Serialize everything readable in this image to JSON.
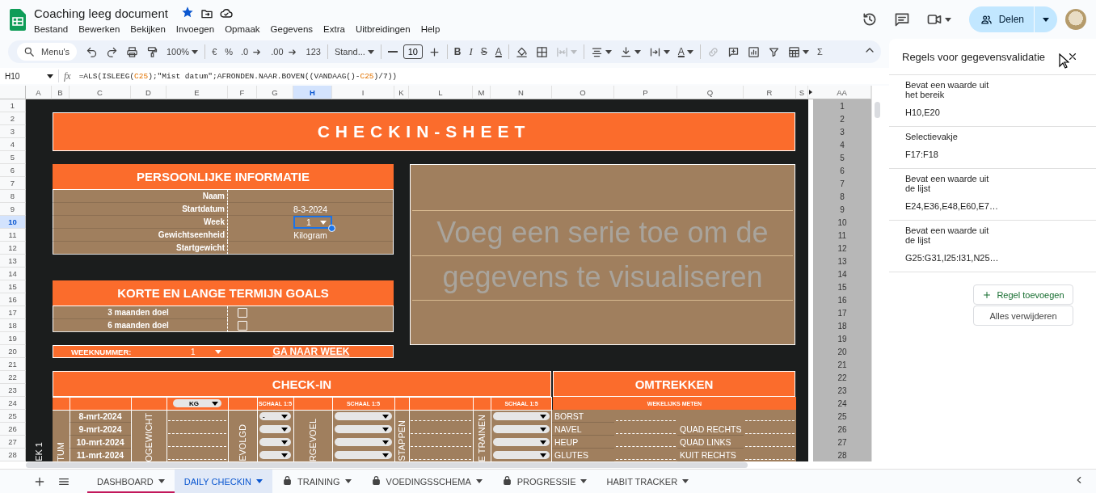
{
  "document": {
    "title": "Coaching leeg document",
    "starred": true
  },
  "menus": [
    "Bestand",
    "Bewerken",
    "Bekijken",
    "Invoegen",
    "Opmaak",
    "Gegevens",
    "Extra",
    "Uitbreidingen",
    "Help"
  ],
  "share": {
    "label": "Delen"
  },
  "toolbar": [
    [
      {
        "kind": "search",
        "placeholder": "Menu's",
        "disabled": false
      },
      {
        "kind": "undo",
        "disabled": false
      },
      {
        "kind": "redo",
        "disabled": false
      },
      {
        "kind": "print",
        "disabled": false
      },
      {
        "kind": "paint-format",
        "disabled": false
      },
      {
        "kind": "zoom",
        "label": "100%",
        "disabled": false
      }
    ],
    [
      {
        "kind": "currency",
        "label": "€",
        "disabled": false
      },
      {
        "kind": "percent",
        "label": "%",
        "disabled": false
      },
      {
        "kind": "decrease-decimals",
        "label": ".0",
        "disabled": false
      },
      {
        "kind": "increase-decimals",
        "label": ".00",
        "disabled": false
      },
      {
        "kind": "number-format",
        "label": "123",
        "disabled": false
      }
    ],
    [
      {
        "kind": "font",
        "label": "Stand...",
        "disabled": false
      }
    ],
    [
      {
        "kind": "minus",
        "disabled": false
      },
      {
        "kind": "size",
        "label": "10",
        "disabled": false
      },
      {
        "kind": "plus",
        "disabled": false
      }
    ],
    [
      {
        "kind": "bold",
        "label": "B",
        "disabled": false
      },
      {
        "kind": "italic",
        "label": "I",
        "disabled": false
      },
      {
        "kind": "strike",
        "label": "S",
        "disabled": false
      },
      {
        "kind": "text-color",
        "label": "A",
        "disabled": false
      }
    ],
    [
      {
        "kind": "fill",
        "disabled": false
      },
      {
        "kind": "borders",
        "disabled": false
      },
      {
        "kind": "merge",
        "disabled": true
      }
    ],
    [
      {
        "kind": "align",
        "disabled": false
      },
      {
        "kind": "valign",
        "disabled": false
      },
      {
        "kind": "wrap",
        "disabled": false
      },
      {
        "kind": "rotate",
        "label": "A",
        "disabled": false
      }
    ],
    [
      {
        "kind": "link",
        "disabled": true
      },
      {
        "kind": "comment",
        "disabled": false
      },
      {
        "kind": "chart",
        "disabled": false
      },
      {
        "kind": "filter",
        "disabled": false
      },
      {
        "kind": "functions-table",
        "disabled": false
      },
      {
        "kind": "sigma",
        "label": "Σ",
        "disabled": false
      }
    ]
  ],
  "formula_bar": {
    "cell": "H10",
    "fx": "fx",
    "segments": [
      {
        "kind": "text",
        "text": "=ALS(ISLEEG("
      },
      {
        "kind": "ref",
        "text": "C25"
      },
      {
        "kind": "text",
        "text": ");\"Mist datum\";AFRONDEN.NAAR.BOVEN((VANDAAG()-"
      },
      {
        "kind": "ref",
        "text": "C25"
      },
      {
        "kind": "text",
        "text": ")/7))"
      }
    ]
  },
  "columns": [
    {
      "label": "A",
      "selected": false
    },
    {
      "label": "B",
      "selected": false
    },
    {
      "label": "C",
      "selected": false
    },
    {
      "label": "D",
      "selected": false
    },
    {
      "label": "E",
      "selected": false
    },
    {
      "label": "F",
      "selected": false
    },
    {
      "label": "G",
      "selected": false
    },
    {
      "label": "H",
      "selected": true
    },
    {
      "label": "I",
      "selected": false
    },
    {
      "label": "K",
      "selected": false
    },
    {
      "label": "L",
      "selected": false
    },
    {
      "label": "M",
      "selected": false
    },
    {
      "label": "N",
      "selected": false
    },
    {
      "label": "O",
      "selected": false
    },
    {
      "label": "P",
      "selected": false
    },
    {
      "label": "Q",
      "selected": false
    },
    {
      "label": "R",
      "selected": false
    },
    {
      "label": "S",
      "selected": false
    },
    {
      "label": "AA",
      "selected": false
    }
  ],
  "rows": [
    {
      "label": "1",
      "selected": false
    },
    {
      "label": "2",
      "selected": false
    },
    {
      "label": "3",
      "selected": false
    },
    {
      "label": "4",
      "selected": false
    },
    {
      "label": "5",
      "selected": false
    },
    {
      "label": "6",
      "selected": false
    },
    {
      "label": "7",
      "selected": false
    },
    {
      "label": "8",
      "selected": false
    },
    {
      "label": "9",
      "selected": false
    },
    {
      "label": "10",
      "selected": true
    },
    {
      "label": "11",
      "selected": false
    },
    {
      "label": "12",
      "selected": false
    },
    {
      "label": "13",
      "selected": false
    },
    {
      "label": "14",
      "selected": false
    },
    {
      "label": "15",
      "selected": false
    },
    {
      "label": "16",
      "selected": false
    },
    {
      "label": "17",
      "selected": false
    },
    {
      "label": "18",
      "selected": false
    },
    {
      "label": "19",
      "selected": false
    },
    {
      "label": "20",
      "selected": false
    },
    {
      "label": "21",
      "selected": false
    },
    {
      "label": "22",
      "selected": false
    },
    {
      "label": "23",
      "selected": false
    },
    {
      "label": "24",
      "selected": false
    },
    {
      "label": "25",
      "selected": false
    },
    {
      "label": "26",
      "selected": false
    },
    {
      "label": "27",
      "selected": false
    },
    {
      "label": "28",
      "selected": false
    }
  ],
  "banner": "CHECKIN-SHEET",
  "personal": {
    "title": "PERSOONLIJKE INFORMATIE",
    "rows": [
      {
        "label": "Naam",
        "kind": "text",
        "selected": false
      },
      {
        "label": "Startdatum",
        "value": "8-3-2024",
        "kind": "text",
        "selected": false
      },
      {
        "label": "Week",
        "value": "1",
        "kind": "dropdown",
        "selected": true
      },
      {
        "label": "Gewichtseenheid",
        "value": "Kilogram",
        "kind": "text",
        "selected": false
      },
      {
        "label": "Startgewicht",
        "kind": "text",
        "selected": false
      }
    ]
  },
  "chart_placeholder": {
    "message": "Voeg een serie toe om de gegevens te visualiseren"
  },
  "goals": {
    "title": "KORTE EN LANGE TERMIJN GOALS",
    "rows": [
      {
        "label": "3 maanden doel",
        "checked": false
      },
      {
        "label": "6 maanden doel",
        "checked": false
      }
    ]
  },
  "week_picker": {
    "label": "WEEKNUMMER:",
    "value": "1",
    "link": "GA NAAR WEEK"
  },
  "checkin": {
    "title": "CHECK-IN",
    "week": "EK 1",
    "dates": [
      "8-mrt-2024",
      "9-mrt-2024",
      "10-mrt-2024",
      "11-mrt-2024"
    ],
    "columns": [
      {
        "kind": "label",
        "text": "TUM"
      },
      {
        "kind": "date"
      },
      {
        "kind": "label",
        "text": "OGEWICHT"
      },
      {
        "kind": "input",
        "unit": "KG"
      },
      {
        "kind": "label",
        "text": "EVOLGD"
      },
      {
        "kind": "scale",
        "header": "SCHAAL 1:5",
        "values": [
          "-"
        ]
      },
      {
        "kind": "label",
        "text": "RGEVOEL"
      },
      {
        "kind": "scale",
        "header": "SCHAAL 1:5"
      },
      {
        "kind": "label",
        "text": "STAPPEN"
      },
      {
        "kind": "input"
      },
      {
        "kind": "label",
        "text": "E TRAINEN"
      },
      {
        "kind": "scale",
        "header": "SCHAAL 1:5"
      }
    ]
  },
  "omtrekken": {
    "title": "OMTREKKEN",
    "subtitle": "WEKELIJKS METEN",
    "rows": [
      {
        "left": "BORST"
      },
      {
        "left": "NAVEL",
        "right": "QUAD RECHTS"
      },
      {
        "left": "HEUP",
        "right": "QUAD LINKS"
      },
      {
        "left": "GLUTES",
        "right": "KUIT RECHTS"
      }
    ]
  },
  "aa_values": [
    "1",
    "2",
    "3",
    "4",
    "5",
    "6",
    "7",
    "8",
    "9",
    "10",
    "11",
    "12",
    "13",
    "14",
    "15",
    "16",
    "17",
    "18",
    "19",
    "20",
    "21",
    "22",
    "23",
    "24",
    "25",
    "26",
    "27",
    "28"
  ],
  "validation_panel": {
    "title": "Regels voor gegevensvalidatie",
    "rules": [
      {
        "criterion": "Bevat een waarde uit het bereik",
        "range": "H10,E20"
      },
      {
        "criterion": "Selectievakje",
        "range": "F17:F18"
      },
      {
        "criterion": "Bevat een waarde uit de lijst",
        "range": "E24,E36,E48,E60,E7…"
      },
      {
        "criterion": "Bevat een waarde uit de lijst",
        "range": "G25:G31,I25:I31,N25…"
      }
    ],
    "add_button": "Regel toevoegen",
    "clear_button": "Alles verwijderen"
  },
  "sheet_tabs": [
    {
      "label": "DASHBOARD",
      "selected": false,
      "locked": false,
      "color": "#c2185b"
    },
    {
      "label": "DAILY CHECKIN",
      "selected": true,
      "locked": false
    },
    {
      "label": "TRAINING",
      "selected": false,
      "locked": true
    },
    {
      "label": "VOEDINGSSCHEMA",
      "selected": false,
      "locked": true
    },
    {
      "label": "PROGRESSIE",
      "selected": false,
      "locked": true
    },
    {
      "label": "HABIT TRACKER",
      "selected": false,
      "locked": false
    }
  ]
}
